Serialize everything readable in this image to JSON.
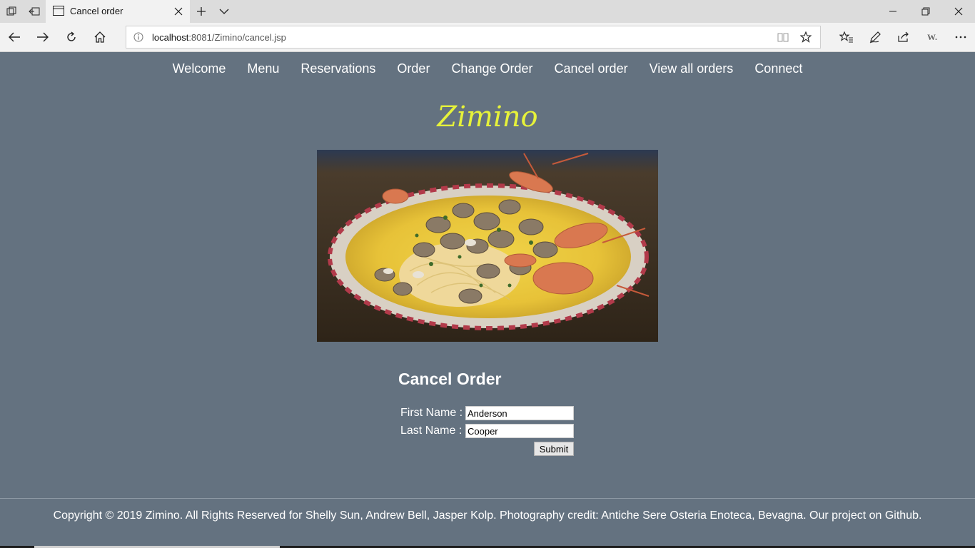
{
  "browser": {
    "tab_title": "Cancel order",
    "url_host": "localhost",
    "url_rest": ":8081/Zimino/cancel.jsp"
  },
  "nav": {
    "items": [
      "Welcome",
      "Menu",
      "Reservations",
      "Order",
      "Change Order",
      "Cancel order",
      "View all orders",
      "Connect"
    ]
  },
  "brand": {
    "logo": "Zimino"
  },
  "form": {
    "title": "Cancel Order",
    "first_name_label": "First Name :",
    "first_name_value": "Anderson",
    "last_name_label": "Last Name :",
    "last_name_value": "Cooper",
    "submit_label": "Submit"
  },
  "footer": {
    "text": "Copyright © 2019 Zimino. All Rights Reserved for Shelly Sun, Andrew Bell, Jasper Kolp. Photography credit: Antiche Sere Osteria Enoteca, Bevagna. Our project on Github."
  },
  "colors": {
    "page_bg": "#647280",
    "logo": "#e6f23a",
    "text": "#ffffff"
  }
}
